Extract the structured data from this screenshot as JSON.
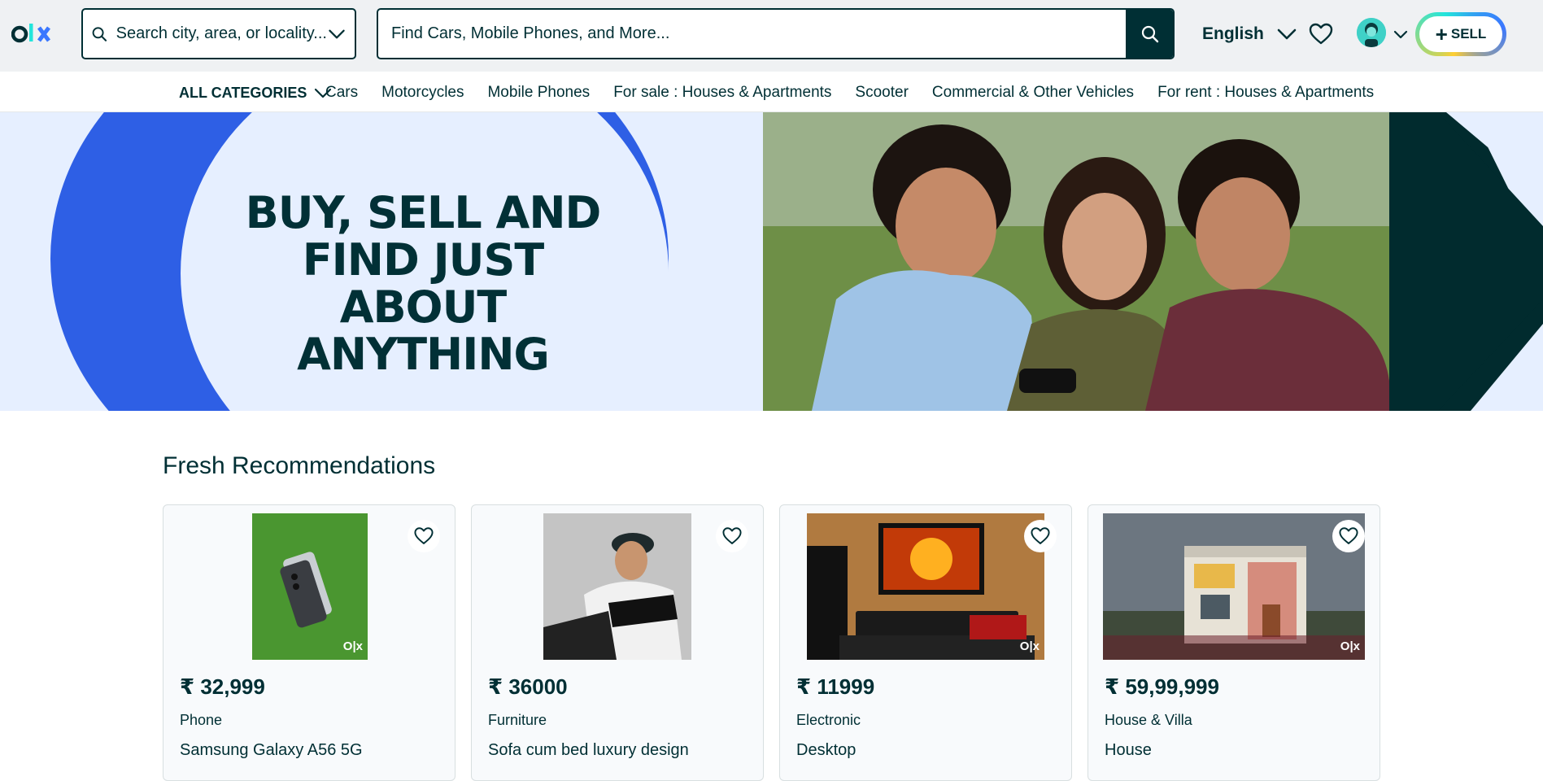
{
  "header": {
    "location_placeholder": "Search city, area, or locality...",
    "search_placeholder": "Find Cars, Mobile Phones, and More...",
    "language": "English",
    "sell_label": "SELL"
  },
  "nav": {
    "all_categories": "ALL CATEGORIES",
    "items": [
      "Cars",
      "Motorcycles",
      "Mobile Phones",
      "For sale : Houses & Apartments",
      "Scooter",
      "Commercial & Other Vehicles",
      "For rent : Houses & Apartments"
    ]
  },
  "hero": {
    "line1": "BUY, SELL AND",
    "line2": "FIND JUST ABOUT",
    "line3": "ANYTHING"
  },
  "recommendations": {
    "title": "Fresh Recommendations",
    "cards": [
      {
        "price": "₹ 32,999",
        "category": "Phone",
        "title": "Samsung Galaxy A56 5G"
      },
      {
        "price": "₹ 36000",
        "category": "Furniture",
        "title": "Sofa cum bed luxury design"
      },
      {
        "price": "₹ 11999",
        "category": "Electronic",
        "title": "Desktop"
      },
      {
        "price": "₹ 59,99,999",
        "category": "House & Villa",
        "title": "House"
      }
    ]
  }
}
